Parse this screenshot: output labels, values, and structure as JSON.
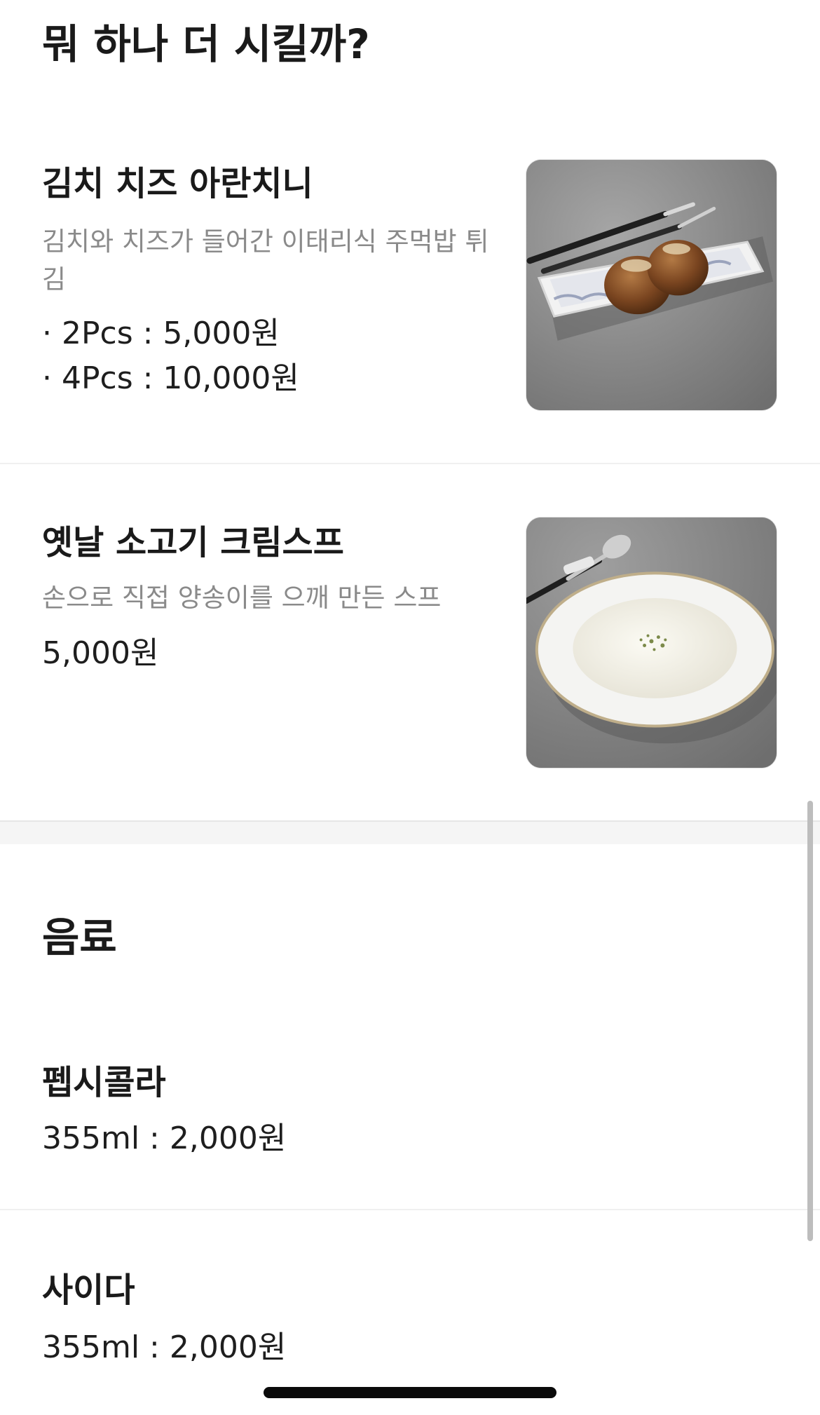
{
  "sections": {
    "more": {
      "title": "뭐 하나 더 시킬까?",
      "items": [
        {
          "name": "김치 치즈 아란치니",
          "description": "김치와 치즈가 들어간 이태리식 주먹밥 튀김",
          "prices": [
            "· 2Pcs : 5,000원",
            "· 4Pcs : 10,000원"
          ],
          "image_icon": "arancini-dish-photo"
        },
        {
          "name": "옛날 소고기 크림스프",
          "description": "손으로 직접 양송이를 으깨 만든 스프",
          "prices": [
            "5,000원"
          ],
          "image_icon": "cream-soup-dish-photo"
        }
      ]
    },
    "drinks": {
      "title": "음료",
      "items": [
        {
          "name": "펩시콜라",
          "prices": [
            "355ml : 2,000원"
          ]
        },
        {
          "name": "사이다",
          "prices": [
            "355ml : 2,000원"
          ]
        }
      ]
    }
  },
  "colors": {
    "text_primary": "#1a1a1a",
    "text_secondary": "#8a8a8a",
    "divider": "#f0f0f0",
    "section_gap": "#f5f5f5",
    "photo_background": "#8f8f8f"
  }
}
